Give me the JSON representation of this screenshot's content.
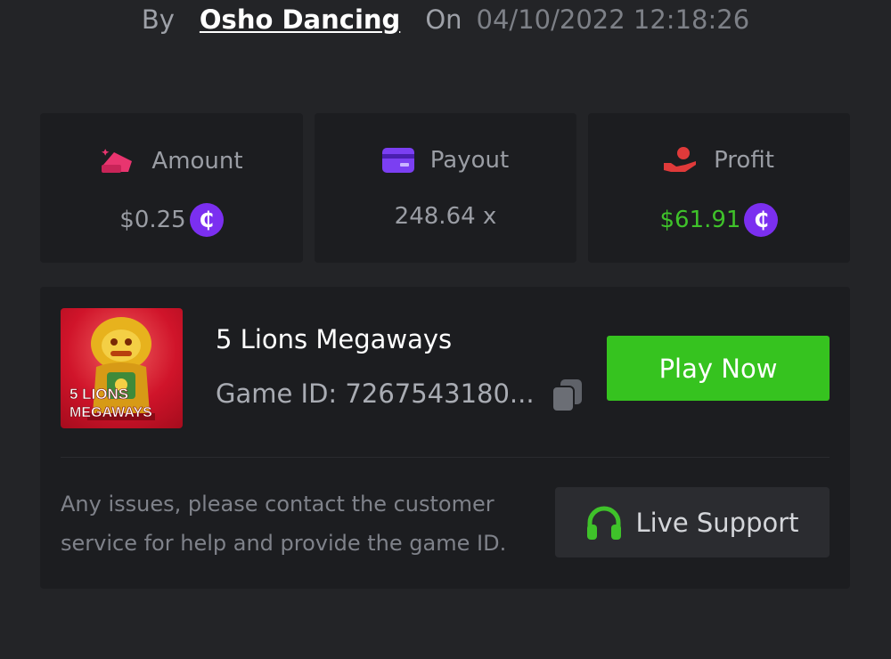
{
  "bet_meta": {
    "by_label": "By",
    "username": "Osho Dancing",
    "on_label": "On",
    "datetime": "04/10/2022 12:18:26"
  },
  "stats": {
    "amount": {
      "label": "Amount",
      "value": "$0.25",
      "icon": "wallet-icon",
      "color": "#e8356f"
    },
    "payout": {
      "label": "Payout",
      "value": "248.64 x",
      "icon": "card-icon",
      "color": "#7b3ff2"
    },
    "profit": {
      "label": "Profit",
      "value": "$61.91",
      "icon": "hand-coin-icon",
      "color": "#e03a3a",
      "value_color": "#3fc22a"
    },
    "currency_symbol": "₵"
  },
  "game": {
    "title": "5 Lions Megaways",
    "id_text": "Game ID: 7267543180...",
    "thumb_line1": "5 LIONS",
    "thumb_line2": "MEGAWAYS",
    "play_label": "Play Now"
  },
  "support": {
    "help_text": "Any issues, please contact the customer service for help and provide the game ID.",
    "button_label": "Live Support"
  },
  "colors": {
    "background": "#232427",
    "card": "#1c1d20",
    "accent_green": "#36c31f",
    "coin_purple": "#7b2ff0"
  }
}
